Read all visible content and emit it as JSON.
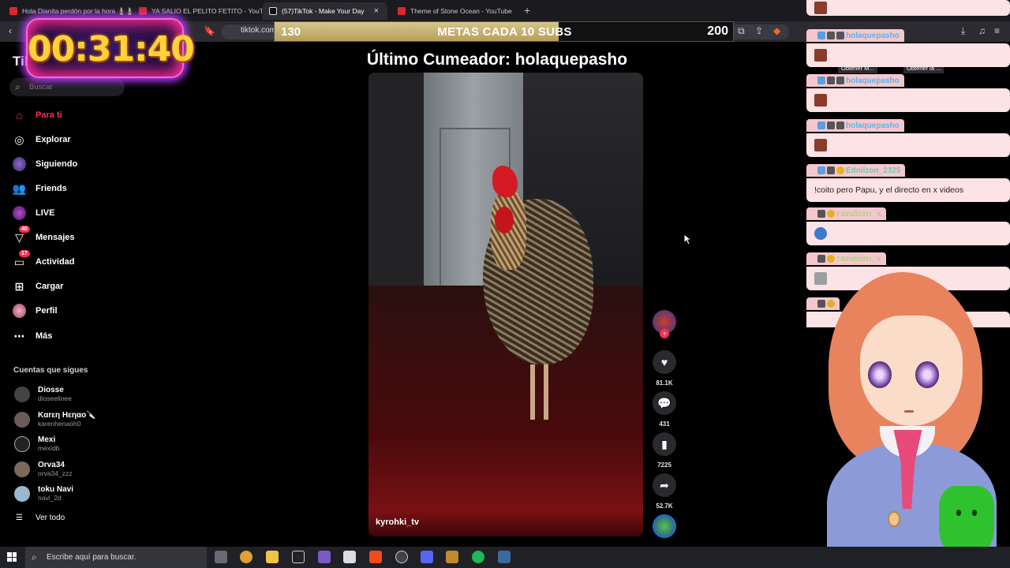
{
  "browser": {
    "tabs": [
      {
        "title": "Hola Dianita perdón por la hora 🎍🎍",
        "type": "yt",
        "active": false
      },
      {
        "title": "YA SALIO EL PELITO FETITO - YouTube",
        "type": "yt",
        "active": false
      },
      {
        "title": "(57)TikTok - Make Your Day",
        "type": "tt",
        "active": true
      },
      {
        "title": "Theme of Stone Ocean - YouTube",
        "type": "yt",
        "active": false
      }
    ],
    "url": "tiktok.com",
    "tiktok_buttons": [
      "Obtener M...",
      "Obtener la ..."
    ]
  },
  "overlay": {
    "timer": "00:31:40",
    "goal": {
      "start": "130",
      "title": "METAS CADA 10 SUBS",
      "end": "200",
      "progress_fraction": 0.62
    },
    "last_cumeador": "Último Cumeador: holaquepasho"
  },
  "tiktok": {
    "logo": "TikTok",
    "search_placeholder": "Buscar",
    "nav": [
      {
        "label": "Para ti",
        "icon": "home-icon",
        "active": true
      },
      {
        "label": "Explorar",
        "icon": "compass-icon"
      },
      {
        "label": "Siguiendo",
        "icon": "following-avatar-icon"
      },
      {
        "label": "Friends",
        "icon": "friends-icon"
      },
      {
        "label": "LIVE",
        "icon": "live-icon"
      },
      {
        "label": "Mensajes",
        "icon": "messages-icon",
        "badge": "40"
      },
      {
        "label": "Actividad",
        "icon": "activity-icon",
        "badge": "17"
      },
      {
        "label": "Cargar",
        "icon": "upload-icon"
      },
      {
        "label": "Perfil",
        "icon": "profile-avatar-icon"
      },
      {
        "label": "Más",
        "icon": "more-icon"
      }
    ],
    "following_title": "Cuentas que sigues",
    "following": [
      {
        "name": "Diosse",
        "user": "dioseelinee"
      },
      {
        "name": "Kαrεη Hεηαo🔪",
        "user": "karenhenaoh0"
      },
      {
        "name": "Mexi",
        "user": "mexidb"
      },
      {
        "name": "Orva34",
        "user": "orva34_zzz"
      },
      {
        "name": "toku Navi",
        "user": "navi_2d"
      }
    ],
    "see_all": "Ver todo",
    "video": {
      "author": "kyrohki_tv",
      "likes": "81.1K",
      "comments": "431",
      "saves": "7225",
      "shares": "52.7K"
    }
  },
  "chat": {
    "messages": [
      {
        "user": "",
        "text": "",
        "emote": true
      },
      {
        "user": "holaquepasho",
        "text": "",
        "emote": true,
        "color": "blue"
      },
      {
        "user": "holaquepasho",
        "text": "",
        "emote": true,
        "color": "blue"
      },
      {
        "user": "holaquepasho",
        "text": "",
        "emote": true,
        "color": "blue"
      },
      {
        "user": "Ednilzon_2325",
        "text": "!coito pero Papu, y el directo en x videos",
        "emote": false,
        "color": "teal"
      },
      {
        "user": "𝕣𝕒𝕟𝕕𝕠𝕞_𝕩",
        "text": "",
        "emote": true,
        "color": "green"
      },
      {
        "user": "𝕣𝕒𝕟𝕕𝕠𝕞_𝕩",
        "text": "",
        "emote": true,
        "color": "green"
      }
    ]
  },
  "taskbar": {
    "search_placeholder": "Escribe aquí para buscar."
  },
  "colors": {
    "tiktok_red": "#fe2c55",
    "timer_yellow": "#ffd23a",
    "chat_pink": "#fde2e6"
  }
}
